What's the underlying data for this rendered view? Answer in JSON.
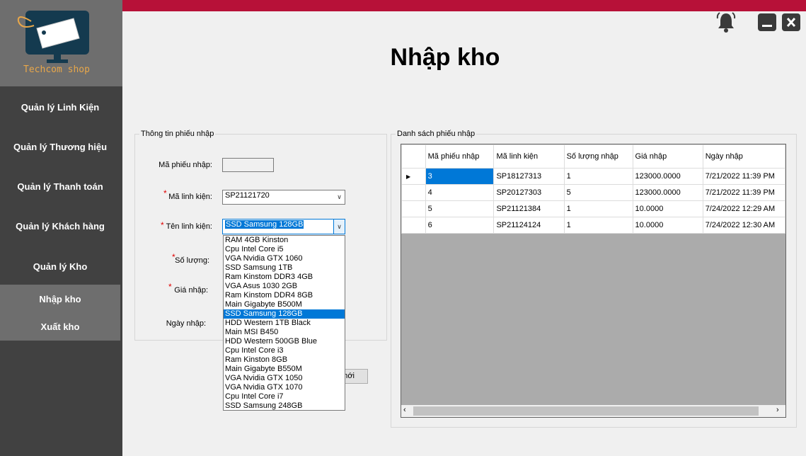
{
  "brand": {
    "logo_text": "Techcom shop"
  },
  "sidebar": {
    "items": [
      {
        "label": "Quản lý Linh Kiện"
      },
      {
        "label": "Quản lý Thương hiệu"
      },
      {
        "label": "Quản lý Thanh toán"
      },
      {
        "label": "Quản lý Khách hàng"
      },
      {
        "label": "Quản lý Kho"
      }
    ],
    "sub_items": [
      {
        "label": "Nhập kho"
      },
      {
        "label": "Xuất kho"
      }
    ]
  },
  "header": {
    "title": "Nhập kho"
  },
  "form": {
    "group_title": "Thông tin phiếu nhập",
    "required_mark": "*",
    "ma_phieu_label": "Mã phiếu nhập:",
    "ma_phieu_value": "",
    "ma_linh_kien_label": "Mã linh kiện:",
    "ma_linh_kien_value": "SP21121720",
    "ten_linh_kien_label": "Tên linh kiện:",
    "ten_linh_kien_value": "SSD Samsung 128GB",
    "so_luong_label": "Số lượng:",
    "gia_nhap_label": "Giá nhập:",
    "ngay_nhap_label": "Ngày nhập:",
    "button_partial": "mới"
  },
  "dropdown": {
    "selected": "SSD Samsung 128GB",
    "options": [
      "RAM 4GB Kinston",
      "Cpu Intel Core i5",
      "VGA Nvidia GTX 1060",
      "SSD Samsung 1TB",
      "Ram Kinstom DDR3 4GB",
      "VGA Asus 1030 2GB",
      "Ram Kinstom DDR4 8GB",
      "Main Gigabyte B500M",
      "SSD Samsung 128GB",
      "HDD Western 1TB Black",
      "Main MSI B450",
      "HDD Western 500GB Blue",
      "Cpu Intel Core i3",
      "Ram Kinston 8GB",
      "Main Gigabyte B550M",
      "VGA Nvidia GTX 1050",
      "VGA Nvidia GTX 1070",
      "Cpu Intel Core i7",
      "SSD Samsung 248GB"
    ]
  },
  "list": {
    "group_title": "Danh sách phiếu nhập",
    "columns": [
      "Mã phiếu nhập",
      "Mã linh kiện",
      "Số lượng nhập",
      "Giá nhập",
      "Ngày nhập"
    ],
    "rows": [
      [
        "3",
        "SP18127313",
        "1",
        "123000.0000",
        "7/21/2022 11:39 PM"
      ],
      [
        "4",
        "SP20127303",
        "5",
        "123000.0000",
        "7/21/2022 11:39 PM"
      ],
      [
        "5",
        "SP21121384",
        "1",
        "10.0000",
        "7/24/2022 12:29 AM"
      ],
      [
        "6",
        "SP21124124",
        "1",
        "10.0000",
        "7/24/2022 12:30 AM"
      ]
    ]
  },
  "icons": {
    "bell": "bell-icon",
    "minimize": "minimize-icon",
    "close": "close-icon"
  },
  "colors": {
    "accent": "#b71138",
    "sidebar": "#414141",
    "logo_bg": "#6e6e6e",
    "selection": "#0078d7"
  }
}
